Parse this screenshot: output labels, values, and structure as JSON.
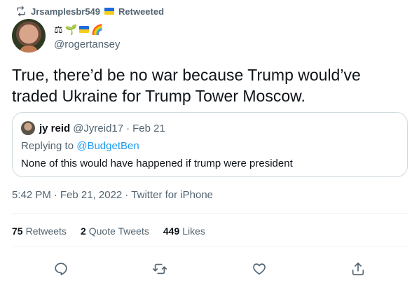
{
  "retweet_header": {
    "user": "Jrsamplesbr549",
    "label": "Retweeted",
    "icon": "retweet-icon"
  },
  "author": {
    "emojis": [
      "⚖",
      "🌱",
      "🇺🇦",
      "🌈"
    ],
    "handle": "@rogertansey"
  },
  "tweet": {
    "text": "True, there’d be no war because Trump would’ve traded Ukraine for Trump Tower Moscow."
  },
  "quoted_tweet": {
    "name": "jy reid",
    "handle": "@Jyreid17",
    "separator": "·",
    "date": "Feb 21",
    "replying_prefix": "Replying to ",
    "replying_to": "@BudgetBen",
    "text": "None of this would have happened if trump were president"
  },
  "meta": {
    "time": "5:42 PM",
    "separator": "·",
    "date": "Feb 21, 2022",
    "source": "Twitter for iPhone"
  },
  "stats": {
    "retweets_count": "75",
    "retweets_label": "Retweets",
    "quotes_count": "2",
    "quotes_label": "Quote Tweets",
    "likes_count": "449",
    "likes_label": "Likes"
  },
  "actions": [
    "reply-icon",
    "retweet-icon",
    "like-icon",
    "share-icon"
  ],
  "colors": {
    "accent": "#1d9bf0",
    "text": "#0f1419",
    "secondary": "#536471",
    "border": "#cfd9de"
  }
}
